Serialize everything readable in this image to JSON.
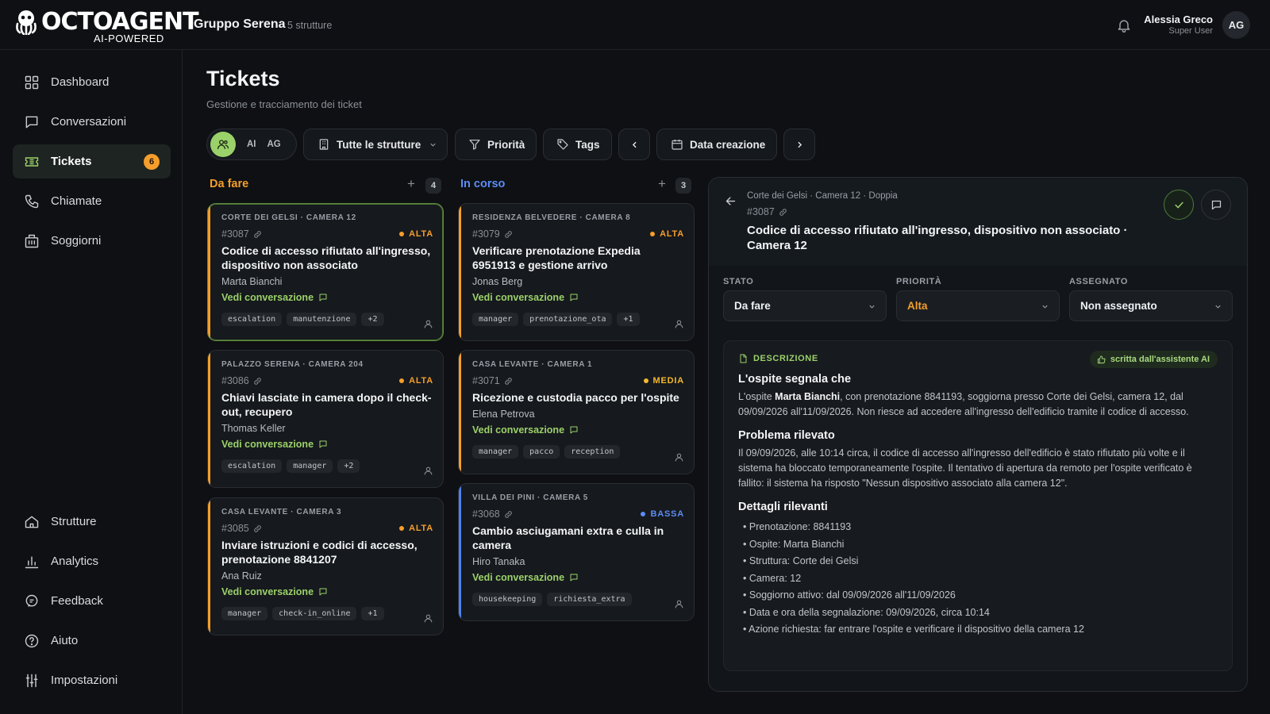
{
  "brand": {
    "name": "OCTOAGENT",
    "tagline": "AI-POWERED"
  },
  "header": {
    "org_name": "Gruppo Serena",
    "org_count": "5 strutture",
    "user_name": "Alessia Greco",
    "user_role": "Super User",
    "user_initials": "AG"
  },
  "sidebar": {
    "top": [
      {
        "label": "Dashboard",
        "icon": "grid-icon"
      },
      {
        "label": "Conversazioni",
        "icon": "chat-icon"
      },
      {
        "label": "Tickets",
        "icon": "ticket-icon",
        "badge": "6",
        "active": true
      },
      {
        "label": "Chiamate",
        "icon": "phone-icon"
      },
      {
        "label": "Soggiorni",
        "icon": "building-icon"
      }
    ],
    "bottom": [
      {
        "label": "Strutture",
        "icon": "home-icon"
      },
      {
        "label": "Analytics",
        "icon": "bar-chart-icon"
      },
      {
        "label": "Feedback",
        "icon": "feedback-icon"
      },
      {
        "label": "Aiuto",
        "icon": "help-icon"
      },
      {
        "label": "Impostazioni",
        "icon": "sliders-icon"
      }
    ]
  },
  "page": {
    "title": "Tickets",
    "subtitle": "Gestione e tracciamento dei ticket"
  },
  "filters": {
    "seg_ai": "AI",
    "seg_ag": "AG",
    "structures": "Tutte le strutture",
    "priority": "Priorità",
    "tags": "Tags",
    "date": "Data creazione"
  },
  "columns": [
    {
      "title": "Da fare",
      "count": "4",
      "color": "#f59e2b"
    },
    {
      "title": "In corso",
      "count": "3",
      "color": "#5b8cf5"
    }
  ],
  "cards_todo": [
    {
      "location": "CORTE DEI GELSI · CAMERA 12",
      "id": "#3087",
      "priority": "ALTA",
      "title": "Codice di accesso rifiutato all'ingresso, dispositivo non associato",
      "guest": "Marta Bianchi",
      "link": "Vedi conversazione",
      "tags": [
        "escalation",
        "manutenzione",
        "+2"
      ]
    },
    {
      "location": "PALAZZO SERENA · CAMERA 204",
      "id": "#3086",
      "priority": "ALTA",
      "title": "Chiavi lasciate in camera dopo il check-out, recupero",
      "guest": "Thomas Keller",
      "link": "Vedi conversazione",
      "tags": [
        "escalation",
        "manager",
        "+2"
      ]
    },
    {
      "location": "CASA LEVANTE · CAMERA 3",
      "id": "#3085",
      "priority": "ALTA",
      "title": "Inviare istruzioni e codici di accesso, prenotazione 8841207",
      "guest": "Ana Ruiz",
      "link": "Vedi conversazione",
      "tags": [
        "manager",
        "check-in_online",
        "+1"
      ]
    }
  ],
  "cards_progress": [
    {
      "location": "RESIDENZA BELVEDERE · CAMERA 8",
      "id": "#3079",
      "priority": "ALTA",
      "title": "Verificare prenotazione Expedia 6951913 e gestione arrivo",
      "guest": "Jonas Berg",
      "link": "Vedi conversazione",
      "tags": [
        "manager",
        "prenotazione_ota",
        "+1"
      ]
    },
    {
      "location": "CASA LEVANTE · CAMERA 1",
      "id": "#3071",
      "priority": "MEDIA",
      "title": "Ricezione e custodia pacco per l'ospite",
      "guest": "Elena Petrova",
      "link": "Vedi conversazione",
      "tags": [
        "manager",
        "pacco",
        "reception"
      ]
    },
    {
      "location": "VILLA DEI PINI · CAMERA 5",
      "id": "#3068",
      "priority": "BASSA",
      "title": "Cambio asciugamani extra e culla in camera",
      "guest": "Hiro Tanaka",
      "link": "Vedi conversazione",
      "tags": [
        "housekeeping",
        "richiesta_extra"
      ]
    }
  ],
  "colors": {
    "alta": "#f59e2b",
    "media": "#f5b82b",
    "bassa": "#5b8cf5",
    "accent": "#9bd16a"
  },
  "detail": {
    "location": "Corte dei Gelsi · Camera 12 · Doppia",
    "id": "#3087",
    "title": "Codice di accesso rifiutato all'ingresso, dispositivo non associato · Camera 12",
    "stato_label": "STATO",
    "stato_value": "Da fare",
    "priorita_label": "PRIORITÀ",
    "priorita_value": "Alta",
    "assegnato_label": "ASSEGNATO",
    "assegnato_value": "Non assegnato",
    "desc_label": "DESCRIZIONE",
    "ai_badge": "scritta dall'assistente AI",
    "h1": "L'ospite segnala che",
    "p1_a": "L'ospite ",
    "p1_name": "Marta Bianchi",
    "p1_b": ", con prenotazione 8841193, soggiorna presso Corte dei Gelsi, camera 12, dal 09/09/2026 all'11/09/2026. Non riesce ad accedere all'ingresso dell'edificio tramite il codice di accesso.",
    "h2": "Problema rilevato",
    "p2": "Il 09/09/2026, alle 10:14 circa, il codice di accesso all'ingresso dell'edificio è stato rifiutato più volte e il sistema ha bloccato temporaneamente l'ospite. Il tentativo di apertura da remoto per l'ospite verificato è fallito: il sistema ha risposto \"Nessun dispositivo associato alla camera 12\".",
    "h3": "Dettagli rilevanti",
    "details": [
      "Prenotazione: 8841193",
      "Ospite: Marta Bianchi",
      "Struttura: Corte dei Gelsi",
      "Camera: 12",
      "Soggiorno attivo: dal 09/09/2026 all'11/09/2026",
      "Data e ora della segnalazione: 09/09/2026, circa 10:14",
      "Azione richiesta: far entrare l'ospite e verificare il dispositivo della camera 12"
    ]
  }
}
